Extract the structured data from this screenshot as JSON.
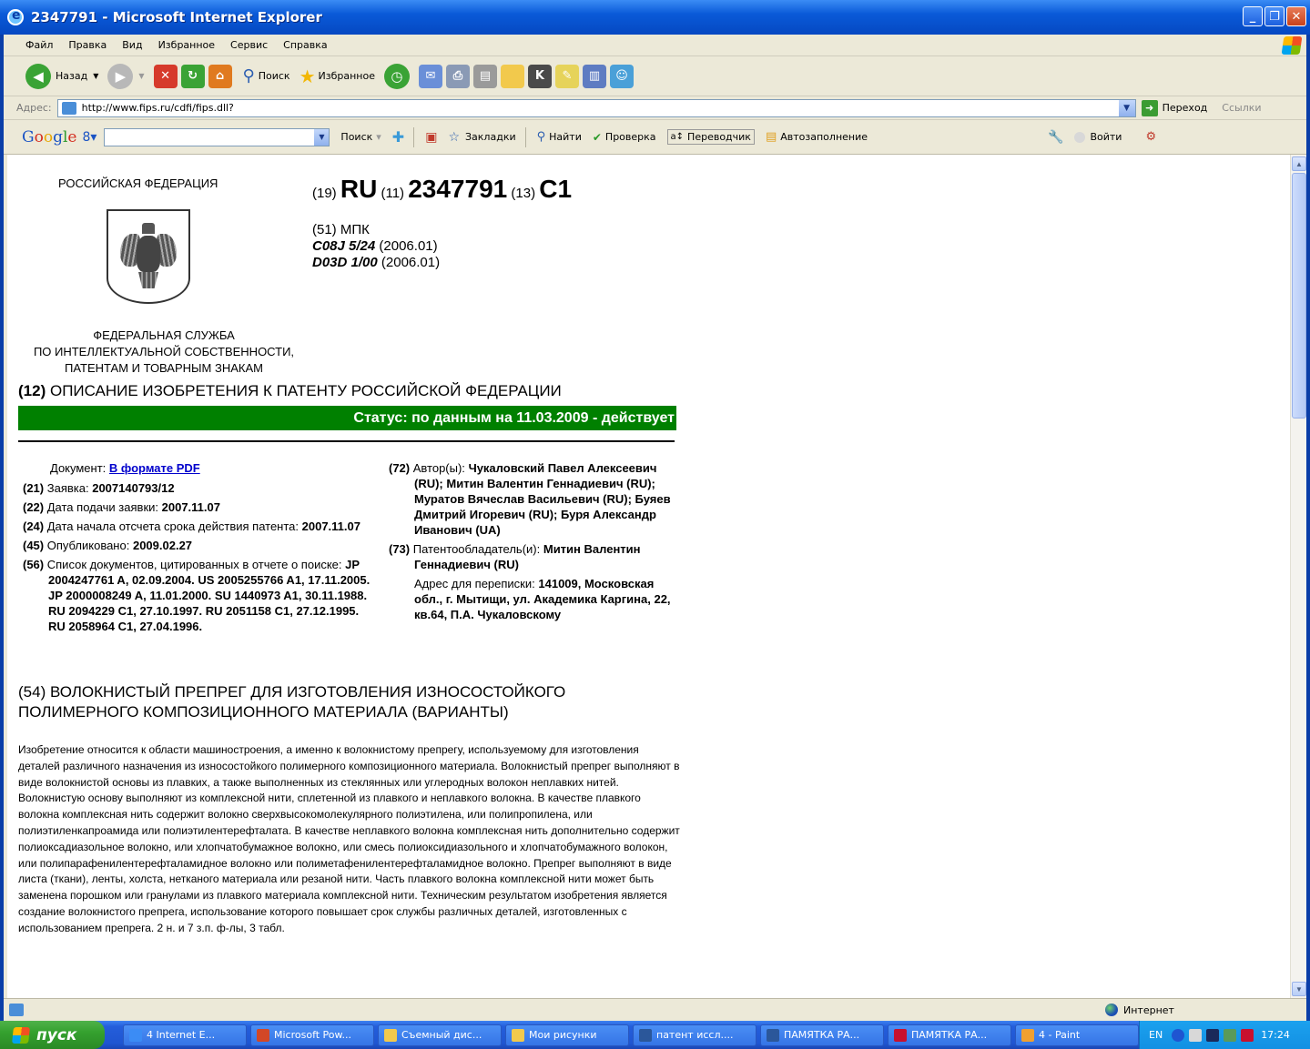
{
  "window": {
    "title": "2347791 - Microsoft Internet Explorer"
  },
  "menu": [
    "Файл",
    "Правка",
    "Вид",
    "Избранное",
    "Сервис",
    "Справка"
  ],
  "toolbar": {
    "back": "Назад",
    "search": "Поиск",
    "favorites": "Избранное"
  },
  "address": {
    "label": "Адрес:",
    "url": "http://www.fips.ru/cdfi/fips.dll?",
    "go": "Переход",
    "links": "Ссылки"
  },
  "google": {
    "search": "Поиск",
    "bookmarks": "Закладки",
    "find": "Найти",
    "check": "Проверка",
    "translate": "Переводчик",
    "autofill": "Автозаполнение",
    "signin": "Войти"
  },
  "patent": {
    "country_header": "РОССИЙСКАЯ ФЕДЕРАЦИЯ",
    "code19": "(19)",
    "country": "RU",
    "code11": "(11)",
    "number": "2347791",
    "code13": "(13)",
    "kind": "C1",
    "mpk_label": "(51) МПК",
    "ipc": [
      {
        "code": "C08J 5/24",
        "version": "(2006.01)"
      },
      {
        "code": "D03D 1/00",
        "version": "(2006.01)"
      }
    ],
    "agency": [
      "ФЕДЕРАЛЬНАЯ СЛУЖБА",
      "ПО ИНТЕЛЛЕКТУАЛЬНОЙ СОБСТВЕННОСТИ,",
      "ПАТЕНТАМ И ТОВАРНЫМ ЗНАКАМ"
    ],
    "desc_code": "(12)",
    "desc_title": "ОПИСАНИЕ ИЗОБРЕТЕНИЯ К ПАТЕНТУ РОССИЙСКОЙ ФЕДЕРАЦИИ",
    "status": "Статус: по данным на 11.03.2009 - действует",
    "document_label": "Документ:",
    "document_link": "В формате PDF",
    "app_code": "(21)",
    "app_label": "Заявка:",
    "app_value": "2007140793/12",
    "filed_code": "(22)",
    "filed_label": "Дата подачи заявки:",
    "filed_value": "2007.11.07",
    "start_code": "(24)",
    "start_label": "Дата начала отсчета срока действия патента:",
    "start_value": "2007.11.07",
    "pub_code": "(45)",
    "pub_label": "Опубликовано:",
    "pub_value": "2009.02.27",
    "cited_code": "(56)",
    "cited_label": "Список документов, цитированных в отчете о поиске:",
    "cited_value": "JP 2004247761 A, 02.09.2004. US 2005255766 A1, 17.11.2005. JP 2000008249 A, 11.01.2000. SU 1440973 A1, 30.11.1988. RU 2094229 C1, 27.10.1997. RU 2051158 C1, 27.12.1995. RU 2058964 C1, 27.04.1996.",
    "authors_code": "(72)",
    "authors_label": "Автор(ы):",
    "authors_value": "Чукаловский Павел Алексеевич (RU); Митин Валентин Геннадиевич (RU); Муратов Вячеслав Васильевич (RU); Буяев Дмитрий Игоревич (RU); Буря Александр Иванович (UA)",
    "owner_code": "(73)",
    "owner_label": "Патентообладатель(и):",
    "owner_value": "Митин Валентин Геннадиевич (RU)",
    "corr_label": "Адрес для переписки:",
    "corr_value": "141009, Московская обл., г. Мытищи, ул. Академика Каргина, 22, кв.64, П.А. Чукаловскому",
    "title_code": "(54)",
    "title": "ВОЛОКНИСТЫЙ ПРЕПРЕГ ДЛЯ ИЗГОТОВЛЕНИЯ ИЗНОСОСТОЙКОГО ПОЛИМЕРНОГО КОМПОЗИЦИОННОГО МАТЕРИАЛА (ВАРИАНТЫ)",
    "abstract": "Изобретение относится к области машиностроения, а именно к волокнистому препрегу, используемому для изготовления деталей различного назначения из износостойкого полимерного композиционного материала. Волокнистый препрег выполняют в виде волокнистой основы из плавких, а также выполненных из стеклянных или углеродных волокон неплавких нитей. Волокнистую основу выполняют из комплексной нити, сплетенной из плавкого и неплавкого волокна. В качестве плавкого волокна комплексная нить содержит волокно сверхвысокомолекулярного полиэтилена, или полипропилена, или полиэтиленкапроамида или полиэтилентерефталата. В качестве неплавкого волокна комплексная нить дополнительно содержит полиоксадиазольное волокно, или хлопчатобумажное волокно, или смесь полиоксидиазольного и хлопчатобумажного волокон, или полипарафенилентерефталамидное волокно или полиметафенилентерефталамидное волокно. Препрег выполняют в виде листа (ткани), ленты, холста, нетканого материала или резаной нити. Часть плавкого волокна комплексной нити может быть заменена порошком или гранулами из плавкого материала комплексной нити. Техническим результатом изобретения является создание волокнистого препрега, использование которого повышает срок службы различных деталей, изготовленных с использованием препрега. 2 н. и 7 з.п. ф-лы, 3 табл."
  },
  "statusbar": {
    "zone": "Интернет"
  },
  "taskbar": {
    "start": "пуск",
    "tasks": [
      {
        "label": "4 Internet E...",
        "color": "#3b8cf5"
      },
      {
        "label": "Microsoft Pow...",
        "color": "#d24726"
      },
      {
        "label": "Съемный дис...",
        "color": "#f2c94c"
      },
      {
        "label": "Мои рисунки",
        "color": "#f2c94c"
      },
      {
        "label": "патент иссл....",
        "color": "#2b579a"
      },
      {
        "label": "ПАМЯТКА РА...",
        "color": "#2b579a"
      },
      {
        "label": "ПАМЯТКА РА...",
        "color": "#c8102e"
      },
      {
        "label": "4 - Paint",
        "color": "#f0a030"
      }
    ],
    "lang": "EN",
    "clock": "17:24"
  }
}
